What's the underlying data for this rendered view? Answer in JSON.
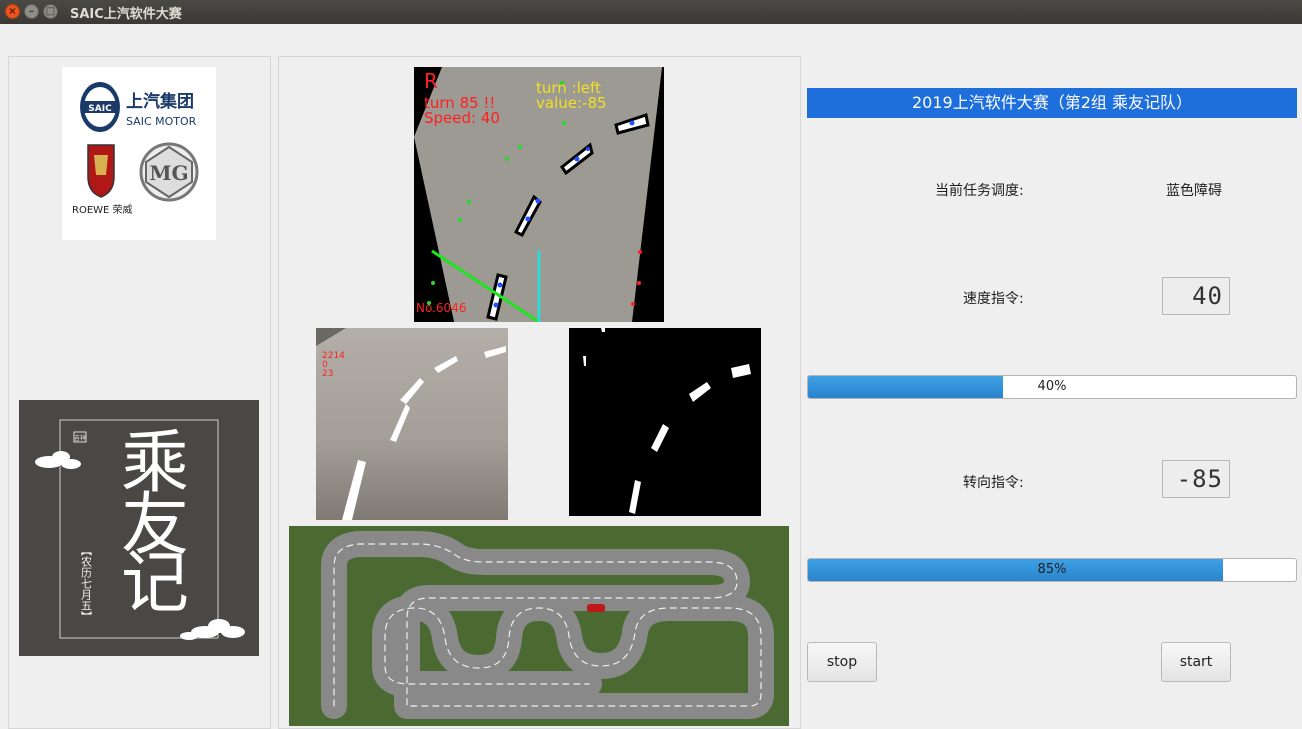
{
  "window": {
    "title": "SAIC上汽软件大赛"
  },
  "logos": {
    "saic": {
      "cn": "上汽集团",
      "en": "SAIC MOTOR",
      "badge": "SAIC",
      "roewe": "ROEWE 荣威",
      "mg": "MG"
    },
    "team": {
      "title": "乘友记",
      "date": "【农历七月五】",
      "stamp": "吉祥"
    }
  },
  "camera": {
    "r_label": "R",
    "turn_text": "turn 85 !!",
    "speed_text": "Speed: 40",
    "turn_dir": "turn :left",
    "value_text": "value:-85",
    "frame_no": "No.6046"
  },
  "raw_overlay": [
    "2214",
    "0",
    "23"
  ],
  "header": {
    "banner": "2019上汽软件大赛（第2组 乘友记队）"
  },
  "task": {
    "label": "当前任务调度:",
    "value": "蓝色障碍"
  },
  "speed": {
    "label": "速度指令:",
    "display": "40",
    "progress": 0.4,
    "progress_text": "40%"
  },
  "steer": {
    "label": "转向指令:",
    "display": "-85",
    "progress": 0.85,
    "progress_text": "85%"
  },
  "buttons": {
    "stop": "stop",
    "start": "start"
  },
  "colors": {
    "banner": "#1e6fdc",
    "progress": "#3498db"
  }
}
